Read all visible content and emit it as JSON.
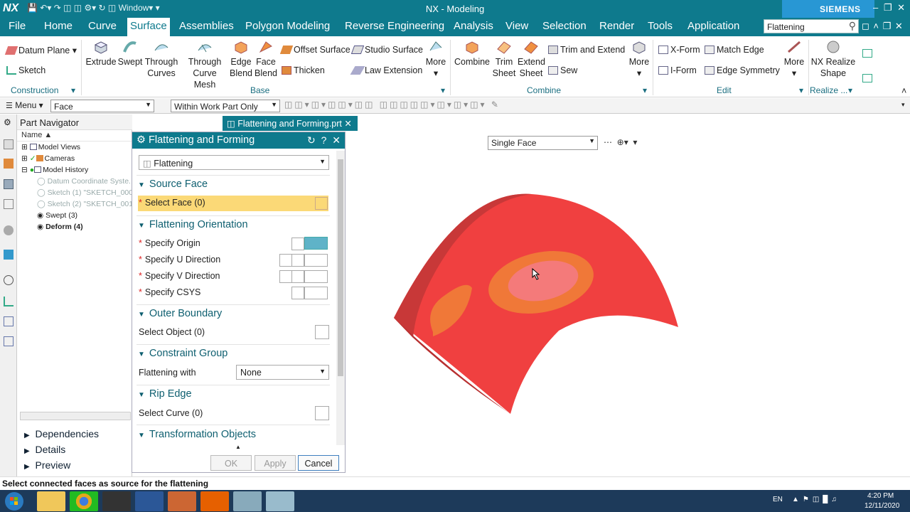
{
  "app": {
    "logo": "NX",
    "title": "NX - Modeling",
    "brand": "SIEMENS",
    "window_menu": "Window"
  },
  "menu": [
    "File",
    "Home",
    "Curve",
    "Surface",
    "Assemblies",
    "Polygon Modeling",
    "Reverse Engineering",
    "Analysis",
    "View",
    "Selection",
    "Render",
    "Tools",
    "Application"
  ],
  "menu_active": "Surface",
  "search": {
    "value": "Flattening"
  },
  "ribbon": {
    "construction": {
      "datum_plane": "Datum Plane",
      "sketch": "Sketch",
      "group": "Construction"
    },
    "base": {
      "extrude": "Extrude",
      "swept": "Swept",
      "through_curves": "Through Curves",
      "through_curve_mesh": "Through Curve Mesh",
      "edge_blend": "Edge Blend",
      "face_blend": "Face Blend",
      "offset_surface": "Offset Surface",
      "studio_surface": "Studio Surface",
      "thicken": "Thicken",
      "law_extension": "Law Extension",
      "more": "More",
      "group": "Base"
    },
    "combine": {
      "combine": "Combine",
      "trim_sheet": "Trim Sheet",
      "extend_sheet": "Extend Sheet",
      "trim_and_extend": "Trim and Extend",
      "sew": "Sew",
      "more": "More",
      "group": "Combine"
    },
    "edit": {
      "x_form": "X-Form",
      "i_form": "I-Form",
      "match_edge": "Match Edge",
      "edge_symmetry": "Edge Symmetry",
      "more": "More",
      "group": "Edit"
    },
    "realize": {
      "nx_realize_shape": "NX Realize Shape",
      "group": "Realize ..."
    }
  },
  "toolbar": {
    "menu": "Menu",
    "filter": "Face",
    "scope": "Within Work Part Only"
  },
  "navigator": {
    "title": "Part Navigator",
    "column": "Name",
    "items": [
      {
        "label": "Model Views",
        "style": "normal"
      },
      {
        "label": "Cameras",
        "style": "normal"
      },
      {
        "label": "Model History",
        "style": "normal"
      },
      {
        "label": "Datum Coordinate Syste...",
        "style": "dim"
      },
      {
        "label": "Sketch (1) \"SKETCH_000\"",
        "style": "dim"
      },
      {
        "label": "Sketch (2) \"SKETCH_001\"",
        "style": "dim"
      },
      {
        "label": "Swept (3)",
        "style": "normal"
      },
      {
        "label": "Deform (4)",
        "style": "bold"
      }
    ],
    "panels": [
      "Dependencies",
      "Details",
      "Preview"
    ]
  },
  "tab": {
    "label": "Flattening and Forming.prt"
  },
  "dialog": {
    "title": "Flattening and Forming",
    "type": "Flattening",
    "source_face": {
      "title": "Source Face",
      "select": "Select Face (0)"
    },
    "orientation": {
      "title": "Flattening Orientation",
      "origin": "Specify Origin",
      "u_dir": "Specify U Direction",
      "v_dir": "Specify V Direction",
      "csys": "Specify CSYS"
    },
    "outer_boundary": {
      "title": "Outer Boundary",
      "select": "Select Object (0)"
    },
    "constraint": {
      "title": "Constraint Group",
      "label": "Flattening with",
      "value": "None"
    },
    "rip_edge": {
      "title": "Rip Edge",
      "select": "Select Curve (0)"
    },
    "transformation": {
      "title": "Transformation Objects"
    },
    "buttons": {
      "ok": "OK",
      "apply": "Apply",
      "cancel": "Cancel"
    }
  },
  "viewport": {
    "selection_filter": "Single Face"
  },
  "status": "Select connected faces as source for the flattening",
  "taskbar": {
    "lang": "EN",
    "time": "4:20 PM",
    "date": "12/11/2020"
  },
  "colors": {
    "accent": "#0e7a8d",
    "surface_red": "#f04040",
    "highlight": "#fbd977"
  }
}
